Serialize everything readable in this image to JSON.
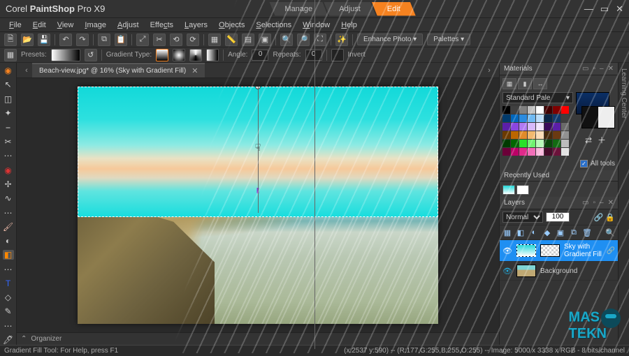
{
  "app": {
    "title_prefix": "Corel ",
    "title_bold": "PaintShop",
    "title_suffix": " Pro X9"
  },
  "modes": [
    "Manage",
    "Adjust",
    "Edit"
  ],
  "active_mode": 2,
  "menu": [
    "File",
    "Edit",
    "View",
    "Image",
    "Adjust",
    "Effects",
    "Layers",
    "Objects",
    "Selections",
    "Window",
    "Help"
  ],
  "toolbar2": {
    "presets_label": "Presets:",
    "gradtype_label": "Gradient Type:",
    "angle_label": "Angle:",
    "angle_value": "0",
    "repeats_label": "Repeats:",
    "repeats_value": "0",
    "invert_label": "Invert"
  },
  "toolbar1": {
    "enhance_label": "Enhance Photo",
    "palettes_label": "Palettes"
  },
  "document": {
    "tab_label": "Beach-view.jpg* @ 16% (Sky with Gradient Fill)"
  },
  "organizer": {
    "label": "Organizer"
  },
  "materials": {
    "title": "Materials",
    "palette_select": "Standard Pale",
    "alltools_label": "All tools",
    "recently_label": "Recently Used",
    "palette_colors": [
      "#000",
      "#404040",
      "#808080",
      "#c0c0c0",
      "#fff",
      "#400000",
      "#800000",
      "#ff0000",
      "#003a6b",
      "#0066bb",
      "#2a8be0",
      "#6fb9f2",
      "#b9ddfb",
      "#0b2747",
      "#123a6b",
      "#3f3f3f",
      "#5b1fa8",
      "#8b46e0",
      "#b17af2",
      "#d7b9fb",
      "#f0e2fe",
      "#3a0b5b",
      "#5b1fa8",
      "#6a6a6a",
      "#6b3a00",
      "#bb6600",
      "#e08b2a",
      "#f2b96f",
      "#fbddb9",
      "#472a0b",
      "#6b3a12",
      "#919191",
      "#003a00",
      "#006600",
      "#2ae02a",
      "#6ff26f",
      "#b9fbb9",
      "#0b470b",
      "#126b12",
      "#bcbcbc",
      "#6b0038",
      "#bb0066",
      "#e02a8b",
      "#f26fb9",
      "#fbb9dd",
      "#470b2a",
      "#6b123a",
      "#e3e3e3"
    ],
    "recent_colors": [
      "linear-gradient(#22d8d8,#fff)",
      "#ffffff"
    ]
  },
  "layers": {
    "title": "Layers",
    "blend": "Normal",
    "opacity": "100",
    "items": [
      {
        "name": "Sky with Gradient Fill",
        "selected": true
      },
      {
        "name": "Background",
        "selected": false
      }
    ]
  },
  "right_tab": "Learning Center",
  "status": {
    "left": "Gradient Fill Tool: For Help, press F1",
    "right": "(x:2537 y:590) -- (R:177,G:255,B:255,O:255) -- Image: 5000 x 3338 x RGB - 8 bits/channel"
  },
  "watermark": {
    "line1": "MAS",
    "line2": "TEKN"
  }
}
